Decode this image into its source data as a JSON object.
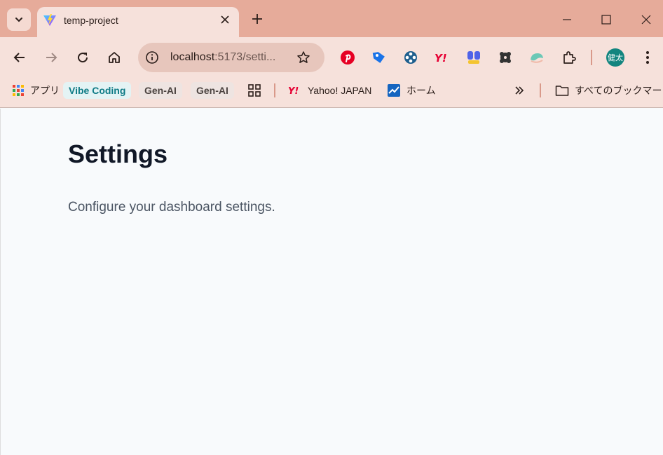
{
  "browser": {
    "tab": {
      "title": "temp-project",
      "favicon": "vite-logo-icon"
    },
    "address": {
      "host": "localhost",
      "path": ":5173/setti..."
    },
    "profile": {
      "label": "健太"
    },
    "extensions": [
      "pinterest-icon",
      "tag-extension-icon",
      "network-extension-icon",
      "yahoo-extension-icon",
      "blocks-extension-icon",
      "puzzle-piece-extension-icon",
      "whale-extension-icon",
      "extensions-icon"
    ],
    "colors": {
      "tabstrip": "#e6ab9a",
      "toolbar": "#f6e1db",
      "profile": "#12857f"
    }
  },
  "bookmarks": {
    "apps": "アプリ",
    "vibe_coding": "Vibe Coding",
    "gen_ai_1": "Gen-AI",
    "gen_ai_2": "Gen-AI",
    "yahoo": "Yahoo! JAPAN",
    "home": "ホーム",
    "all_bookmarks": "すべてのブックマーク"
  },
  "page": {
    "title": "Settings",
    "description": "Configure your dashboard settings."
  }
}
